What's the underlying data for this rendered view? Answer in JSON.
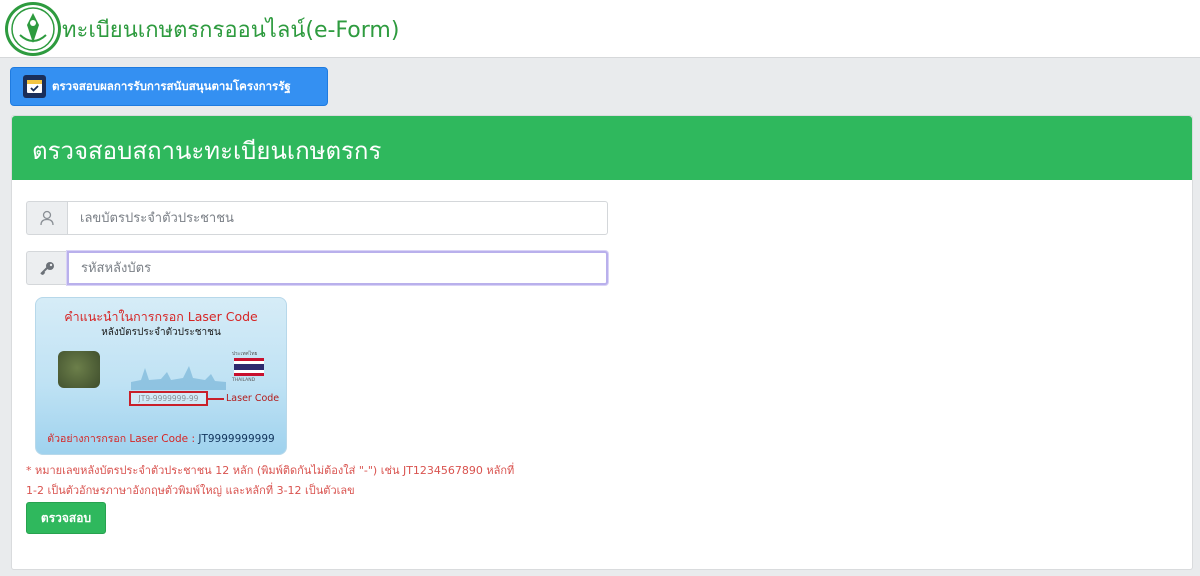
{
  "header": {
    "title": "ทะเบียนเกษตรกรออนไลน์(e-Form)"
  },
  "top_button": {
    "label": "ตรวจสอบผลการรับการสนับสนุนตามโครงการรัฐ"
  },
  "panel": {
    "title": "ตรวจสอบสถานะทะเบียนเกษตรกร"
  },
  "form": {
    "id_input": {
      "placeholder": "เลขบัตรประจำตัวประชาชน",
      "value": "",
      "icon": "user-icon"
    },
    "laser_input": {
      "placeholder": "รหัสหลังบัตร",
      "value": "",
      "icon": "key-icon"
    },
    "submit_label": "ตรวจสอบ"
  },
  "card_illustration": {
    "heading": "คำแนะนำในการกรอก Laser Code",
    "subheading": "หลังบัตรประจำตัวประชาชน",
    "country_label": "ประเทศไทย",
    "country_en": "THAILAND",
    "sample_code": "JT9-9999999-99",
    "code_label": "Laser Code",
    "example_prefix": "ตัวอย่างการกรอก Laser Code : ",
    "example_value": "JT9999999999"
  },
  "note": {
    "line1": "* หมายเลขหลังบัตรประจำตัวประชาชน 12 หลัก (พิมพ์ติดกันไม่ต้องใส่ \"-\") เช่น JT1234567890 หลักที่",
    "line2": "1-2 เป็นตัวอักษรภาษาอังกฤษตัวพิมพ์ใหญ่ และหลักที่ 3-12 เป็นตัวเลข"
  },
  "colors": {
    "accent_green": "#2fb85d",
    "button_blue": "#3490f2",
    "error_red": "#d9534f"
  }
}
